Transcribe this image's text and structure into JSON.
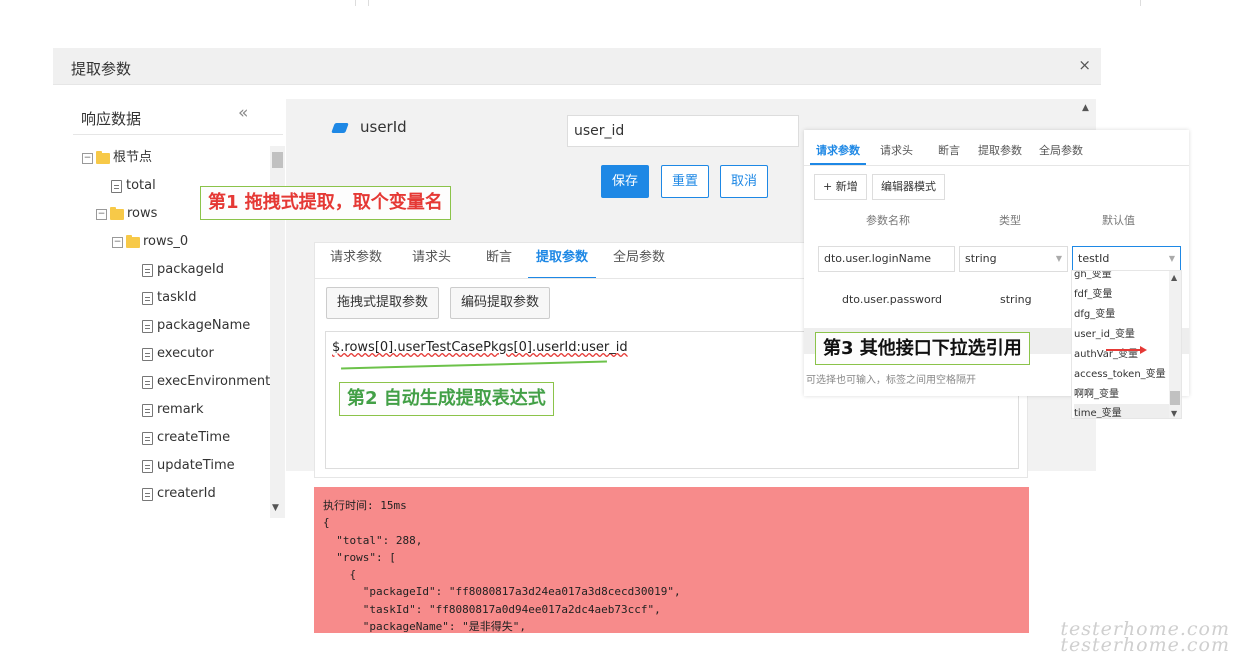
{
  "dialog": {
    "title": "提取参数",
    "close_icon": "×"
  },
  "left": {
    "title": "响应数据",
    "collapse_icon": "«",
    "tree": [
      {
        "label": "根节点",
        "type": "folder",
        "toggle": "−"
      },
      {
        "label": "total",
        "type": "file"
      },
      {
        "label": "rows",
        "type": "folder",
        "toggle": "−"
      },
      {
        "label": "rows_0",
        "type": "folder",
        "toggle": "−"
      },
      {
        "label": "packageId",
        "type": "file"
      },
      {
        "label": "taskId",
        "type": "file"
      },
      {
        "label": "packageName",
        "type": "file"
      },
      {
        "label": "executor",
        "type": "file"
      },
      {
        "label": "execEnvironment",
        "type": "file"
      },
      {
        "label": "remark",
        "type": "file"
      },
      {
        "label": "createTime",
        "type": "file"
      },
      {
        "label": "updateTime",
        "type": "file"
      },
      {
        "label": "createrId",
        "type": "file"
      }
    ]
  },
  "editor": {
    "node_name": "userId",
    "name_input": "user_id",
    "save_label": "保存",
    "reset_label": "重置",
    "cancel_label": "取消",
    "tabs": [
      "请求参数",
      "请求头",
      "断言",
      "提取参数",
      "全局参数"
    ],
    "active_tab": "提取参数",
    "drag_extract_label": "拖拽式提取参数",
    "code_extract_label": "编码提取参数",
    "expression": "$.rows[0].userTestCasePkgs[0].userId:user_id"
  },
  "result": {
    "exec_time_label": "执行时间: 15ms",
    "json_lines": [
      "{",
      "  \"total\": 288,",
      "  \"rows\": [",
      "    {",
      "      \"packageId\": \"ff8080817a3d24ea017a3d8cecd30019\",",
      "      \"taskId\": \"ff8080817a0d94ee017a2dc4aeb73ccf\",",
      "      \"packageName\": \"是非得失\","
    ]
  },
  "annotations": {
    "step1": "第1 拖拽式提取，取个变量名",
    "step2": "第2  自动生成提取表达式",
    "step3": "第3  其他接口下拉选引用"
  },
  "popup": {
    "tabs": [
      "请求参数",
      "请求头",
      "断言",
      "提取参数",
      "全局参数"
    ],
    "active_tab": "请求参数",
    "add_label": "+ 新增",
    "editor_mode_label": "编辑器模式",
    "headers": [
      "参数名称",
      "类型",
      "默认值"
    ],
    "row1": {
      "name": "dto.user.loginName",
      "type": "string",
      "default": "testId"
    },
    "row2": {
      "name": "dto.user.password",
      "type": "string"
    },
    "hint": "可选择也可输入，标签之间用空格隔开",
    "dropdown": [
      "gh_变量",
      "fdf_变量",
      "dfg_变量",
      "user_id_变量",
      "authVar_变量",
      "access_token_变量",
      "啊啊_变量",
      "time_变量"
    ]
  },
  "watermark": [
    "testerhome.com",
    "testerhome.com"
  ],
  "colors": {
    "primary": "#1e88e5",
    "result_bg": "#f78b8b",
    "annotation_red": "#e53935",
    "annotation_green": "#43a047"
  }
}
